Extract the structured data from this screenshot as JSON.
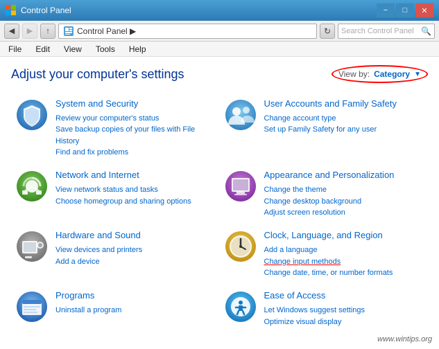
{
  "window": {
    "title": "Control Panel",
    "controls": {
      "minimize": "−",
      "maximize": "□",
      "close": "✕"
    }
  },
  "addressBar": {
    "back": "◀",
    "forward": "▶",
    "up": "↑",
    "breadcrumb": "Control Panel ▶",
    "search_placeholder": "Search Control Panel",
    "search_icon": "🔍",
    "refresh": "↻"
  },
  "menuBar": {
    "items": [
      "File",
      "Edit",
      "View",
      "Tools",
      "Help"
    ]
  },
  "main": {
    "title": "Adjust your computer's settings",
    "viewBy": {
      "label": "View by:",
      "value": "Category",
      "arrow": "▼"
    }
  },
  "categories": [
    {
      "id": "system-security",
      "icon": "🛡️",
      "title": "System and Security",
      "links": [
        "Review your computer's status",
        "Save backup copies of your files with File History",
        "Find and fix problems"
      ]
    },
    {
      "id": "user-accounts",
      "icon": "👥",
      "title": "User Accounts and Family Safety",
      "links": [
        "Change account type",
        "Set up Family Safety for any user"
      ]
    },
    {
      "id": "network-internet",
      "icon": "🌐",
      "title": "Network and Internet",
      "links": [
        "View network status and tasks",
        "Choose homegroup and sharing options"
      ]
    },
    {
      "id": "appearance",
      "icon": "🖼️",
      "title": "Appearance and Personalization",
      "links": [
        "Change the theme",
        "Change desktop background",
        "Adjust screen resolution"
      ]
    },
    {
      "id": "hardware-sound",
      "icon": "🖨️",
      "title": "Hardware and Sound",
      "links": [
        "View devices and printers",
        "Add a device"
      ]
    },
    {
      "id": "clock-language",
      "icon": "🕐",
      "title": "Clock, Language, and Region",
      "links": [
        "Add a language",
        "Change input methods",
        "Change date, time, or number formats"
      ]
    },
    {
      "id": "programs",
      "icon": "📦",
      "title": "Programs",
      "links": [
        "Uninstall a program"
      ]
    },
    {
      "id": "ease-access",
      "icon": "♿",
      "title": "Ease of Access",
      "links": [
        "Let Windows suggest settings",
        "Optimize visual display"
      ]
    }
  ],
  "watermark": "www.wintips.org"
}
